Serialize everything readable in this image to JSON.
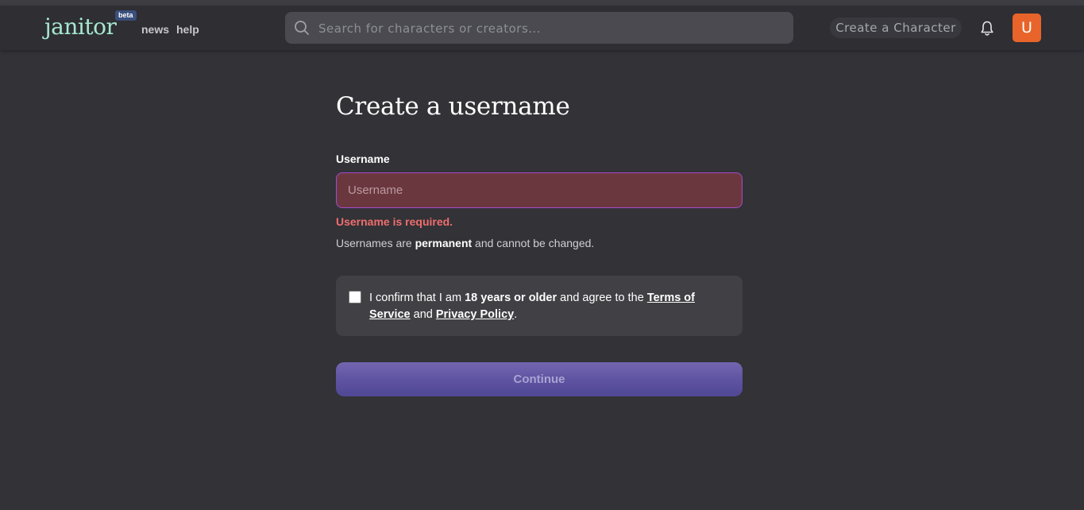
{
  "header": {
    "logo_text": "janitor",
    "beta_badge": "beta",
    "nav": {
      "news": "news",
      "help": "help"
    },
    "search_placeholder": "Search for characters or creators...",
    "create_button": "Create a Character",
    "avatar_initial": "U"
  },
  "form": {
    "title": "Create a username",
    "username_label": "Username",
    "username_placeholder": "Username",
    "username_value": "",
    "error": "Username is required.",
    "hint_prefix": "Usernames are ",
    "hint_bold": "permanent",
    "hint_suffix": " and cannot be changed.",
    "confirm": {
      "checked": false,
      "prefix": "I confirm that I am ",
      "bold": "18 years or older",
      "mid": " and agree to the ",
      "terms_link": "Terms of Service",
      "and": " and ",
      "privacy_link": "Privacy Policy",
      "end": "."
    },
    "continue_button": "Continue"
  },
  "colors": {
    "background": "#323237",
    "header": "#2e2e33",
    "logo": "#a6e8d0",
    "avatar": "#e8642a",
    "input_error_bg": "#6b373e",
    "input_border": "#a54bcf",
    "error_text": "#f06d6d",
    "continue_button": "#5f54a2"
  }
}
